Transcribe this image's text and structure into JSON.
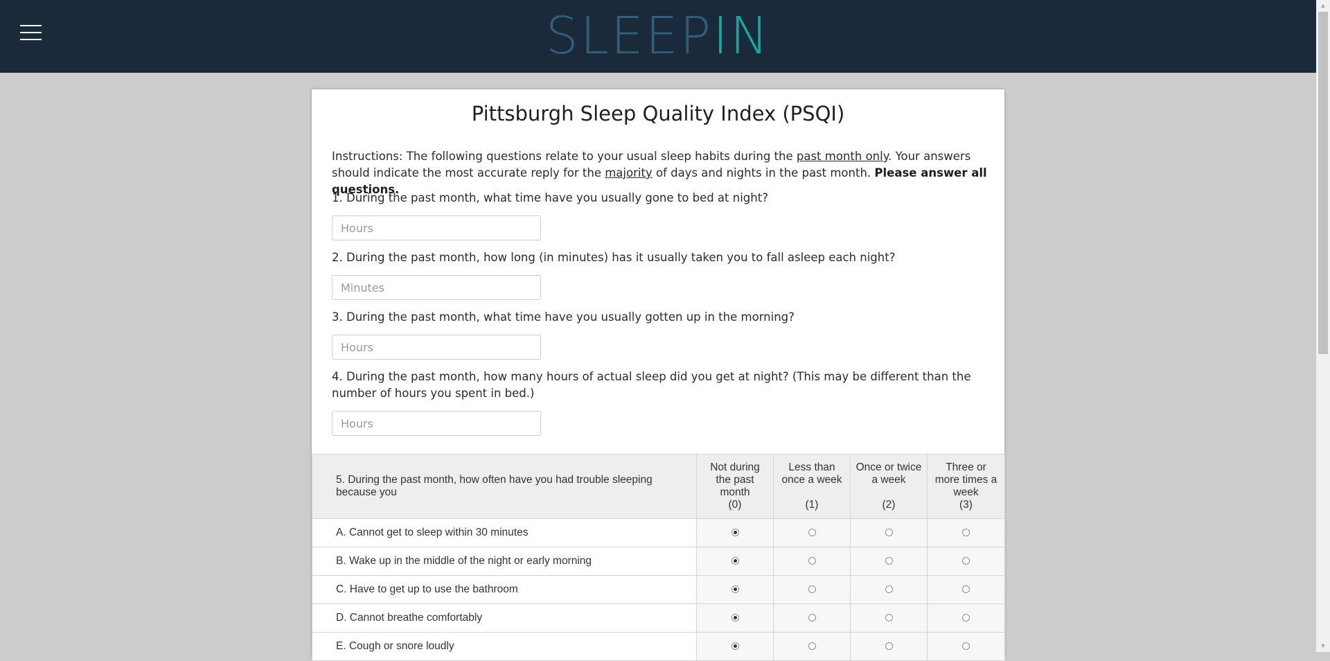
{
  "brand": {
    "part1": "SLEEP",
    "part2": "IN",
    "color_dark": "#2f5f79",
    "color_accent": "#18a6a0"
  },
  "header": {
    "background": "#1b2a3a",
    "menu_icon": "hamburger-icon"
  },
  "form": {
    "title": "Pittsburgh Sleep Quality Index (PSQI)",
    "instructions": {
      "t1": "Instructions: The following questions relate to your usual sleep habits during the ",
      "u1": "past month only",
      "t2": ". Your answers should indicate the most accurate reply for the ",
      "u2": "majority",
      "t3": " of days and nights in the past month. ",
      "bold": "Please answer all questions."
    },
    "questions": [
      {
        "label": "1. During the past month, what time have you usually gone to bed at night?",
        "placeholder": "Hours",
        "value": ""
      },
      {
        "label": "2. During the past month, how long (in minutes) has it usually taken you to fall asleep each night?",
        "placeholder": "Minutes",
        "value": ""
      },
      {
        "label": "3. During the past month, what time have you usually gotten up in the morning?",
        "placeholder": "Hours",
        "value": ""
      },
      {
        "label": "4. During the past month, how many hours of actual sleep did you get at night? (This may be different than the number of hours you spent in bed.)",
        "placeholder": "Hours",
        "value": ""
      }
    ],
    "frequency_table": {
      "question": "5. During the past month, how often have you had trouble sleeping because you",
      "options": [
        {
          "line1": "Not during",
          "line2": "the past",
          "line3": "month",
          "score": "(0)"
        },
        {
          "line1": "Less than",
          "line2": "once a week",
          "line3": "",
          "score": "(1)"
        },
        {
          "line1": "Once or twice",
          "line2": "a week",
          "line3": "",
          "score": "(2)"
        },
        {
          "line1": "Three or",
          "line2": "more times a",
          "line3": "week",
          "score": "(3)"
        }
      ],
      "rows": [
        {
          "label": "A. Cannot get to sleep within 30 minutes",
          "selected": 0
        },
        {
          "label": "B. Wake up in the middle of the night or early morning",
          "selected": 0
        },
        {
          "label": "C. Have to get up to use the bathroom",
          "selected": 0
        },
        {
          "label": "D. Cannot breathe comfortably",
          "selected": 0
        },
        {
          "label": "E. Cough or snore loudly",
          "selected": 0
        }
      ]
    }
  }
}
